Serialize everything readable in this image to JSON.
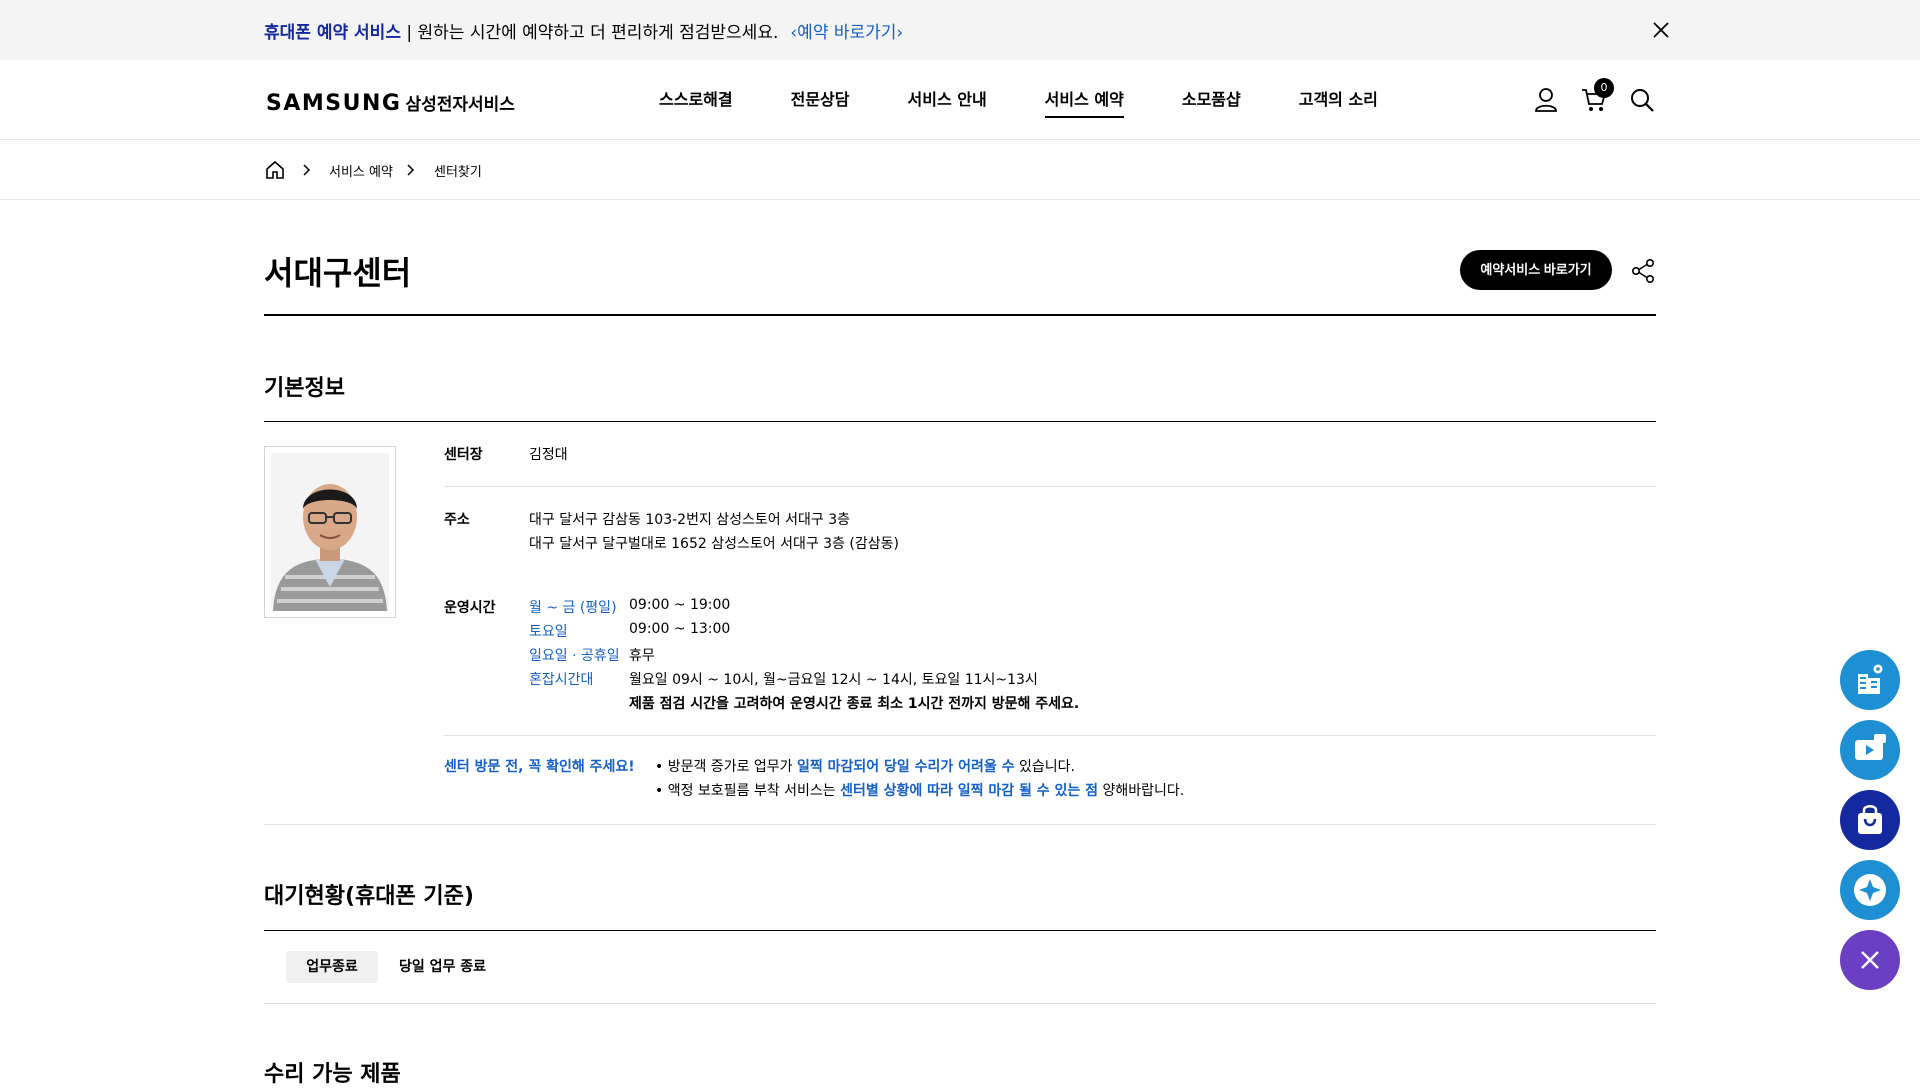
{
  "notice": {
    "highlight": "휴대폰 예약 서비스",
    "message": " | 원하는 시간에 예약하고 더 편리하게 점검받으세요.",
    "link": "‹예약 바로가기›"
  },
  "header": {
    "logo_mark": "SAMSUNG",
    "logo_sub": "삼성전자서비스",
    "menu": [
      "스스로해결",
      "전문상담",
      "서비스 안내",
      "서비스 예약",
      "소모품샵",
      "고객의 소리"
    ],
    "active_menu_index": 3,
    "cart_count": "0"
  },
  "breadcrumb": [
    "서비스 예약",
    "센터찾기"
  ],
  "page": {
    "title": "서대구센터",
    "reserve_button": "예약서비스 바로가기"
  },
  "basic_info": {
    "section_title": "기본정보",
    "manager_label": "센터장",
    "manager_name": "김정대",
    "address_label": "주소",
    "address_1": "대구 달서구 감삼동 103-2번지 삼성스토어 서대구 3층",
    "address_2": "대구 달서구 달구벌대로 1652 삼성스토어 서대구 3층 (감삼동)",
    "hours_label": "운영시간",
    "hours": [
      {
        "day": "월 ~ 금 (평일)",
        "time": "09:00 ~ 19:00"
      },
      {
        "day": "토요일",
        "time": "09:00 ~ 13:00"
      },
      {
        "day": "일요일 · 공휴일",
        "time": "휴무"
      },
      {
        "day": "혼잡시간대",
        "time": "월요일 09시 ~ 10시, 월~금요일 12시 ~ 14시, 토요일 11시~13시"
      }
    ],
    "hours_note": "제품 점검 시간을 고려하여 운영시간 종료 최소 1시간 전까지 방문해 주세요.",
    "visit_notice_label": "센터 방문 전, 꼭 확인해 주세요!",
    "bullet_1_a": "방문객 증가로 업무가 ",
    "bullet_1_b": "일찍 마감되어 당일 수리가 어려울 수",
    "bullet_1_c": " 있습니다.",
    "bullet_2_a": "액정 보호필름 부착 서비스는 ",
    "bullet_2_b": "센터별 상황에 따라 일찍 마감 될 수 있는 점",
    "bullet_2_c": " 양해바랍니다."
  },
  "waiting": {
    "section_title": "대기현황(휴대폰 기준)",
    "badge": "업무종료",
    "text": "당일 업무 종료"
  },
  "repair": {
    "section_title": "수리 가능 제품"
  },
  "colors": {
    "accent_blue": "#1460c8",
    "brand_blue": "#1428a0",
    "fab_blue": "#1e8fd2",
    "fab_purple": "#6a3fc2"
  }
}
